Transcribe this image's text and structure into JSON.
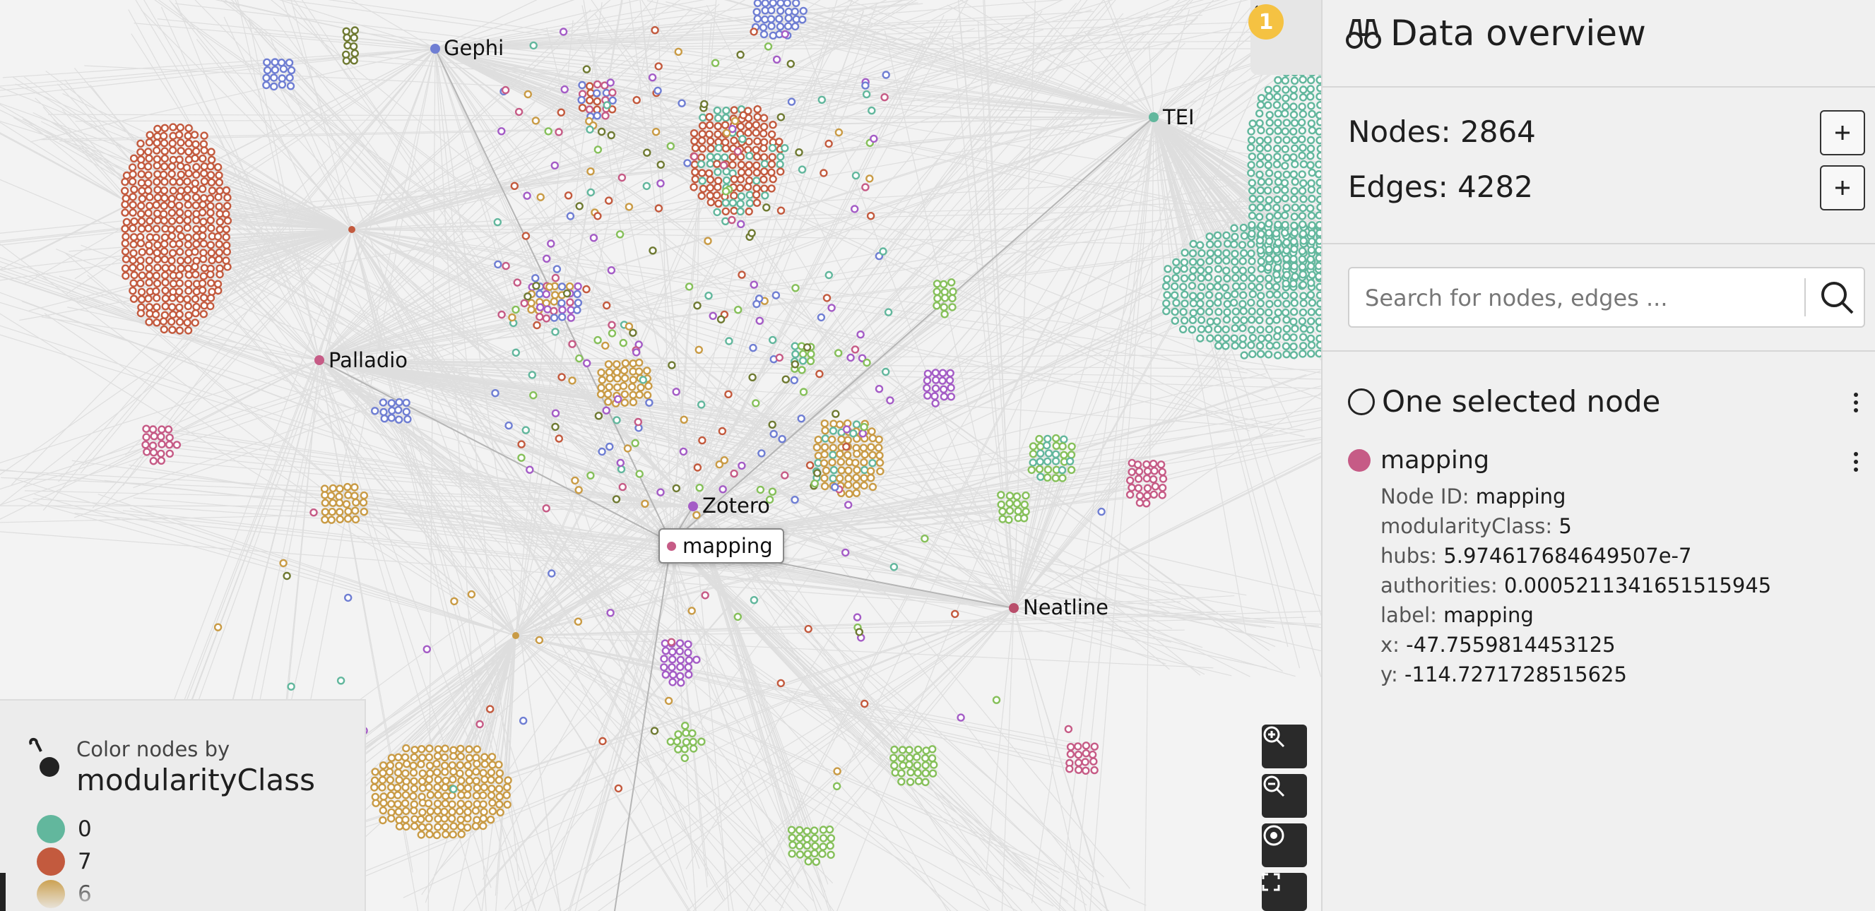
{
  "graph": {
    "labels": [
      {
        "text": "Gephi",
        "color": "#6f7ed3"
      },
      {
        "text": "TEI",
        "color": "#62b79d"
      },
      {
        "text": "Palladio",
        "color": "#c65b86"
      },
      {
        "text": "Zotero",
        "color": "#a45cc6"
      },
      {
        "text": "Neatline",
        "color": "#b94e6b"
      }
    ],
    "hovered": {
      "text": "mapping",
      "color": "#c65b86"
    }
  },
  "toggle": {
    "badge": "1",
    "icon": "double-chevron-right-icon"
  },
  "zoom": {
    "zoom_in_icon": "zoom-in-icon",
    "zoom_out_icon": "zoom-out-icon",
    "center_icon": "target-icon",
    "fullscreen_icon": "fullscreen-icon"
  },
  "legend": {
    "caption_small": "Color nodes by",
    "caption_big": "modularityClass",
    "items": [
      {
        "label": "0",
        "color": "#62b79d"
      },
      {
        "label": "7",
        "color": "#c35a3e"
      },
      {
        "label": "6",
        "color": "#c99b45"
      }
    ]
  },
  "panel": {
    "title": "Data overview",
    "title_icon": "binoculars-icon",
    "nodes_label": "Nodes: 2864",
    "edges_label": "Edges: 4282",
    "search_placeholder": "Search for nodes, edges ...",
    "selection_title": "One selected node",
    "selected_node": {
      "name": "mapping",
      "color": "#c65b86",
      "attributes": [
        {
          "key": "Node ID:",
          "value": "mapping"
        },
        {
          "key": "modularityClass:",
          "value": "5"
        },
        {
          "key": "hubs:",
          "value": "5.974617684649507e-7"
        },
        {
          "key": "authorities:",
          "value": "0.0005211341651515945"
        },
        {
          "key": "label:",
          "value": "mapping"
        },
        {
          "key": "x:",
          "value": "-47.7559814453125"
        },
        {
          "key": "y:",
          "value": "-114.7271728515625"
        }
      ]
    }
  }
}
